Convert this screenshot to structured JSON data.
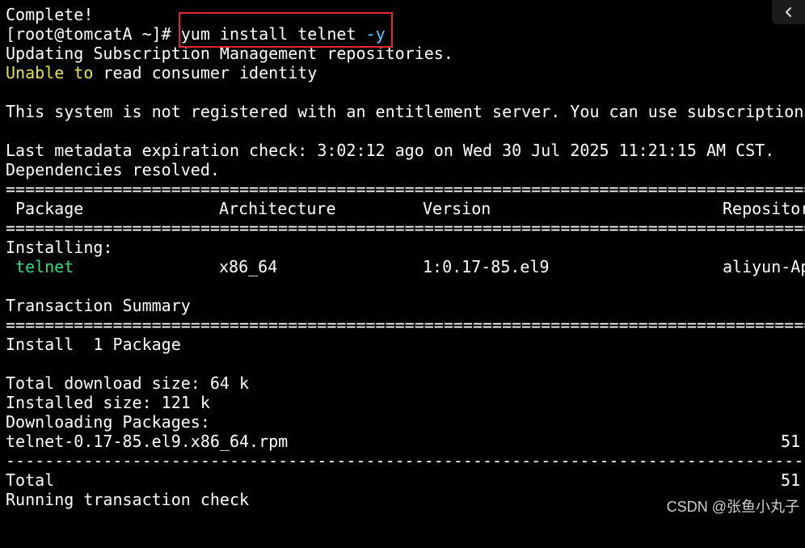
{
  "terminal": {
    "lines": {
      "complete": "Complete!",
      "prompt": "[root@tomcatA ~]# ",
      "command": "yum install telnet ",
      "command_flag": "-y",
      "updating": "Updating Subscription Management repositories.",
      "unable_a": "Unable to",
      "unable_b": " read consumer identity",
      "not_registered": "This system is not registered with an entitlement server. You can use subscription-",
      "metadata": "Last metadata expiration check: 3:02:12 ago on Wed 30 Jul 2025 11:21:15 AM CST.",
      "dependencies": "Dependencies resolved.",
      "separator_double": "===============================================================================================",
      "separator_dash": "-----------------------------------------------------------------------------------------------",
      "installing_label": "Installing:",
      "transaction_summary": "Transaction Summary",
      "install_count": "Install  1 Package",
      "total_download": "Total download size: 64 k",
      "installed_size": "Installed size: 121 k",
      "downloading": "Downloading Packages:",
      "rpm_file": "telnet-0.17-85.el9.x86_64.rpm",
      "rpm_speed": "51",
      "total_label": "Total",
      "total_speed": "51",
      "running_check": "Running transaction check"
    },
    "table": {
      "headers": {
        "package": "Package",
        "architecture": "Architecture",
        "version": "Version",
        "repository": "Repositor"
      },
      "rows": [
        {
          "package": "telnet",
          "architecture": "x86_64",
          "version": "1:0.17-85.el9",
          "repository": "aliyun-Ap"
        }
      ]
    }
  },
  "ui": {
    "collapse_icon": "chevron-left-icon",
    "watermark": "CSDN @张鱼小丸子",
    "highlight_color": "#e8262c"
  }
}
